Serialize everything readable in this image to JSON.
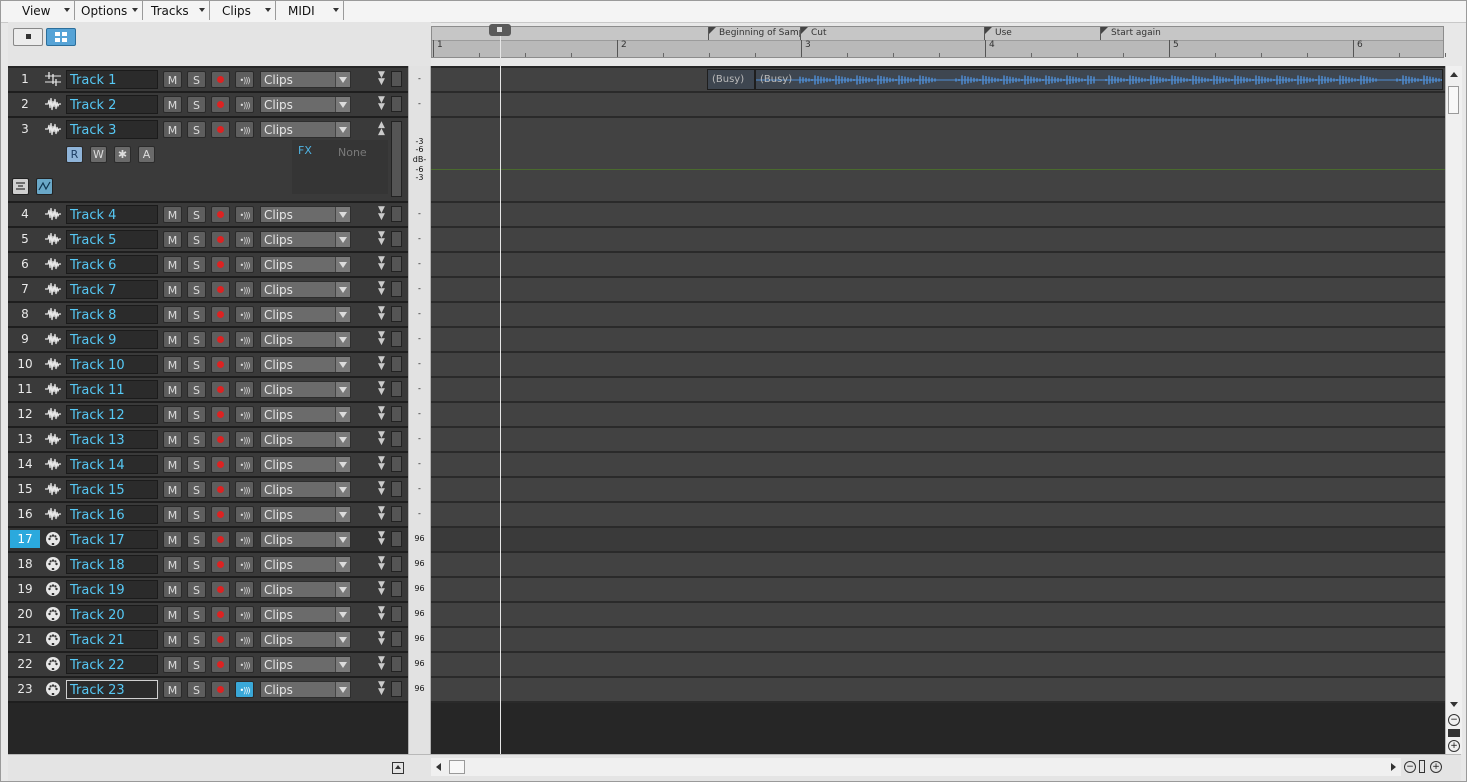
{
  "menu": [
    {
      "label": "View"
    },
    {
      "label": "Options"
    },
    {
      "label": "Tracks"
    },
    {
      "label": "Clips"
    },
    {
      "label": "MIDI"
    }
  ],
  "markers": [
    {
      "label": "Beginning of Samp"
    },
    {
      "label": "Cut"
    },
    {
      "label": "Use"
    },
    {
      "label": "Start again"
    }
  ],
  "bars": [
    "1",
    "2",
    "3",
    "4",
    "5",
    "6"
  ],
  "track3": {
    "buttons": [
      "R",
      "W",
      "✱",
      "A"
    ],
    "fx_label": "FX",
    "fx_value": "None",
    "db_scale": [
      "-3",
      "-6",
      "dB-",
      "-6",
      "-3"
    ]
  },
  "track_buttons": {
    "mute": "M",
    "solo": "S",
    "monitor": "•)))"
  },
  "tracks": [
    {
      "num": "1",
      "name": "Track 1",
      "type": "audio-bus",
      "dropdown": "Clips",
      "vol": "-"
    },
    {
      "num": "2",
      "name": "Track 2",
      "type": "audio",
      "dropdown": "Clips",
      "vol": "-"
    },
    {
      "num": "3",
      "name": "Track 3",
      "type": "audio",
      "dropdown": "Clips",
      "vol": ""
    },
    {
      "num": "4",
      "name": "Track 4",
      "type": "audio",
      "dropdown": "Clips",
      "vol": "-"
    },
    {
      "num": "5",
      "name": "Track 5",
      "type": "audio",
      "dropdown": "Clips",
      "vol": "-"
    },
    {
      "num": "6",
      "name": "Track 6",
      "type": "audio",
      "dropdown": "Clips",
      "vol": "-"
    },
    {
      "num": "7",
      "name": "Track 7",
      "type": "audio",
      "dropdown": "Clips",
      "vol": "-"
    },
    {
      "num": "8",
      "name": "Track 8",
      "type": "audio",
      "dropdown": "Clips",
      "vol": "-"
    },
    {
      "num": "9",
      "name": "Track 9",
      "type": "audio",
      "dropdown": "Clips",
      "vol": "-"
    },
    {
      "num": "10",
      "name": "Track 10",
      "type": "audio",
      "dropdown": "Clips",
      "vol": "-"
    },
    {
      "num": "11",
      "name": "Track 11",
      "type": "audio",
      "dropdown": "Clips",
      "vol": "-"
    },
    {
      "num": "12",
      "name": "Track 12",
      "type": "audio",
      "dropdown": "Clips",
      "vol": "-"
    },
    {
      "num": "13",
      "name": "Track 13",
      "type": "audio",
      "dropdown": "Clips",
      "vol": "-"
    },
    {
      "num": "14",
      "name": "Track 14",
      "type": "audio",
      "dropdown": "Clips",
      "vol": "-"
    },
    {
      "num": "15",
      "name": "Track 15",
      "type": "audio",
      "dropdown": "Clips",
      "vol": "-"
    },
    {
      "num": "16",
      "name": "Track 16",
      "type": "audio",
      "dropdown": "Clips",
      "vol": "-"
    },
    {
      "num": "17",
      "name": "Track 17",
      "type": "midi",
      "dropdown": "Clips",
      "vol": "96",
      "selected": true
    },
    {
      "num": "18",
      "name": "Track 18",
      "type": "midi",
      "dropdown": "Clips",
      "vol": "96"
    },
    {
      "num": "19",
      "name": "Track 19",
      "type": "midi",
      "dropdown": "Clips",
      "vol": "96"
    },
    {
      "num": "20",
      "name": "Track 20",
      "type": "midi",
      "dropdown": "Clips",
      "vol": "96"
    },
    {
      "num": "21",
      "name": "Track 21",
      "type": "midi",
      "dropdown": "Clips",
      "vol": "96"
    },
    {
      "num": "22",
      "name": "Track 22",
      "type": "midi",
      "dropdown": "Clips",
      "vol": "96"
    },
    {
      "num": "23",
      "name": "Track 23",
      "type": "midi",
      "dropdown": "Clips",
      "vol": "96",
      "editing": true,
      "monitor_on": true
    }
  ],
  "clips": [
    {
      "track": "1",
      "label": "(Busy)"
    },
    {
      "track": "1",
      "label": "(Busy)"
    }
  ],
  "colors": {
    "accent": "#2ba9dd",
    "track_name": "#56c8f4",
    "record": "#dd2222",
    "waveform": "#4f8fd6"
  }
}
